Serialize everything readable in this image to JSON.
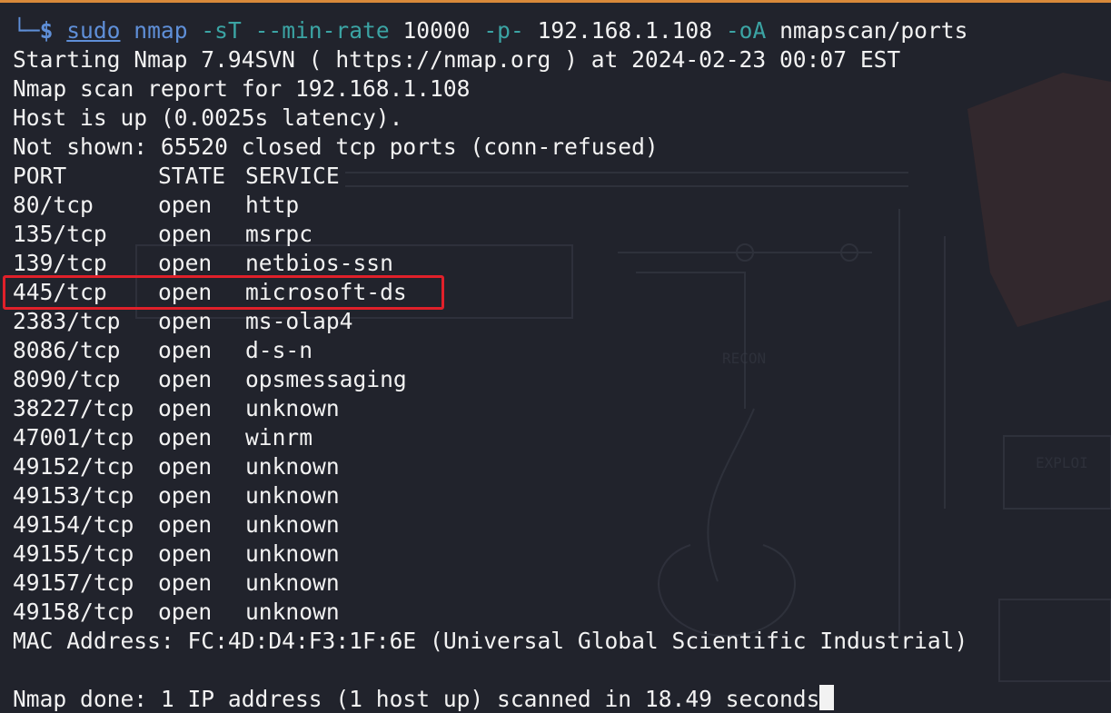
{
  "colors": {
    "background": "#21232c",
    "accent_bar": "#d8893a",
    "prompt": "#5f8fd8",
    "flag": "#3ba4a4",
    "text": "#f2f2f2",
    "highlight": "#e0202a"
  },
  "prompt": {
    "corner": "└─",
    "dollar": "$"
  },
  "command": {
    "sudo": "sudo",
    "bin": "nmap",
    "flag_st": "-sT",
    "flag_minrate": "--min-rate",
    "minrate_value": "10000",
    "flag_p": "-p-",
    "target": "192.168.1.108",
    "flag_oa": "-oA",
    "output": "nmapscan/ports"
  },
  "output": {
    "starting": "Starting Nmap 7.94SVN ( https://nmap.org ) at 2024-02-23 00:07 EST",
    "report": "Nmap scan report for 192.168.1.108",
    "host_up": "Host is up (0.0025s latency).",
    "not_shown": "Not shown: 65520 closed tcp ports (conn-refused)",
    "header": {
      "port": "PORT",
      "state": "STATE",
      "service": "SERVICE"
    },
    "ports": [
      {
        "port": "80/tcp",
        "state": "open",
        "service": "http"
      },
      {
        "port": "135/tcp",
        "state": "open",
        "service": "msrpc"
      },
      {
        "port": "139/tcp",
        "state": "open",
        "service": "netbios-ssn"
      },
      {
        "port": "445/tcp",
        "state": "open",
        "service": "microsoft-ds"
      },
      {
        "port": "2383/tcp",
        "state": "open",
        "service": "ms-olap4"
      },
      {
        "port": "8086/tcp",
        "state": "open",
        "service": "d-s-n"
      },
      {
        "port": "8090/tcp",
        "state": "open",
        "service": "opsmessaging"
      },
      {
        "port": "38227/tcp",
        "state": "open",
        "service": "unknown"
      },
      {
        "port": "47001/tcp",
        "state": "open",
        "service": "winrm"
      },
      {
        "port": "49152/tcp",
        "state": "open",
        "service": "unknown"
      },
      {
        "port": "49153/tcp",
        "state": "open",
        "service": "unknown"
      },
      {
        "port": "49154/tcp",
        "state": "open",
        "service": "unknown"
      },
      {
        "port": "49155/tcp",
        "state": "open",
        "service": "unknown"
      },
      {
        "port": "49157/tcp",
        "state": "open",
        "service": "unknown"
      },
      {
        "port": "49158/tcp",
        "state": "open",
        "service": "unknown"
      }
    ],
    "mac": "MAC Address: FC:4D:D4:F3:1F:6E (Universal Global Scientific Industrial)",
    "done": "Nmap done: 1 IP address (1 host up) scanned in 18.49 seconds"
  }
}
